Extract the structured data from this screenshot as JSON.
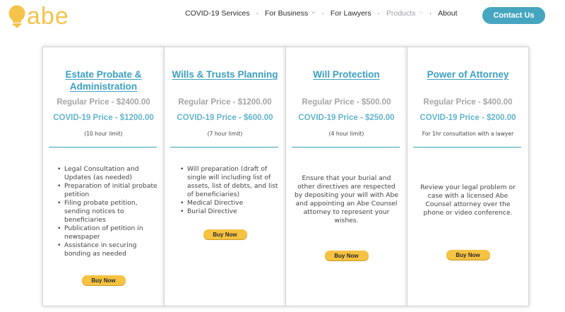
{
  "brand": {
    "logo_text": "abe",
    "logo_color": "#f5c34a"
  },
  "nav": {
    "items": [
      {
        "label": "COVID-19 Services",
        "dropdown": false
      },
      {
        "label": "For Business",
        "dropdown": true
      },
      {
        "label": "For Lawyers",
        "dropdown": false
      },
      {
        "label": "Products",
        "dropdown": true
      },
      {
        "label": "About",
        "dropdown": false
      }
    ],
    "separator": "·",
    "chevron": "chevron-down-icon"
  },
  "contact_button": "Contact Us",
  "colors": {
    "accent": "#46a6c1",
    "title": "#3ba0c2",
    "button": "#f6c241",
    "muted": "#a5a5a5"
  },
  "cards": [
    {
      "title": "Estate Probate & Administration",
      "regular_price": "Regular Price - $2400.00",
      "covid_price": "COVID-19 Price - $1200.00",
      "limit": "(10 hour limit)",
      "features": [
        "Legal Consultation and Updates (as needed)",
        "Preparation of initial probate petition",
        "Filing probate petition, sending notices to beneficiaries",
        "Publication of petition in newspaper",
        "Assistance in securing bonding as needed"
      ],
      "buy_label": "Buy Now"
    },
    {
      "title": "Wills & Trusts Planning",
      "regular_price": "Regular Price - $1200.00",
      "covid_price": "COVID-19 Price - $600.00",
      "limit": "(7 hour limit)",
      "features": [
        "Will preparation (draft of single will including list of assets, list of debts, and list of beneficiaries)",
        "Medical Directive",
        "Burial Directive"
      ],
      "buy_label": "Buy Now"
    },
    {
      "title": "Will Protection",
      "regular_price": "Regular Price - $500.00",
      "covid_price": "COVID-19 Price - $250.00",
      "limit": "(4 hour limit)",
      "description": "Ensure that your burial and other directives are respected by depositing your will with Abe and appointing an Abe Counsel attorney to represent your wishes.",
      "buy_label": "Buy Now"
    },
    {
      "title": "Power of Attorney",
      "regular_price": "Regular Price - $400.00",
      "covid_price": "COVID-19 Price - $200.00",
      "limit": "For 1hr consultation with a lawyer",
      "description": "Review your legal problem or case with a licensed Abe Counsel attorney over the phone or video conference.",
      "buy_label": "Buy Now"
    }
  ]
}
